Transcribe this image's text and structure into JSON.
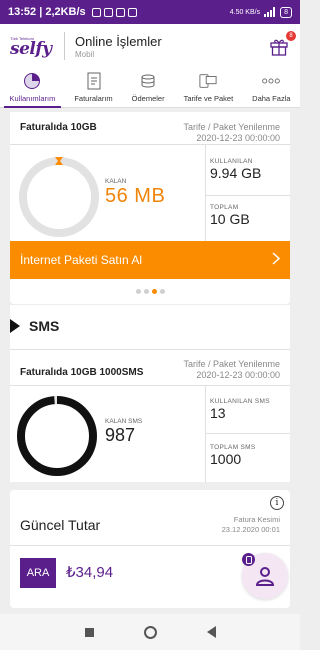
{
  "status_bar": {
    "text": "13:52 | 2,2KB/s",
    "right_small": "4.50 KB/s",
    "battery": "8"
  },
  "header": {
    "logo_small": "Türk Telekom",
    "logo": "selfy",
    "title": "Online İşlemler",
    "subtitle": "Mobil",
    "gift_badge": "8"
  },
  "nav": {
    "items": [
      {
        "label": "Kullanımlarım",
        "icon": "pie-chart-icon"
      },
      {
        "label": "Faturalarım",
        "icon": "receipt-icon"
      },
      {
        "label": "Ödemeler",
        "icon": "coins-icon"
      },
      {
        "label": "Tarife ve Paket",
        "icon": "devices-icon"
      },
      {
        "label": "Daha Fazla",
        "icon": "more-icon"
      }
    ]
  },
  "internet_card": {
    "package": "Faturalıda 10GB",
    "renew_label": "Tarife / Paket Yenilenme",
    "renew_date": "2020-12-23 00:00:00",
    "remaining_label": "KALAN",
    "remaining_value": "56 MB",
    "used_label": "KULLANILAN",
    "used_value": "9.94 GB",
    "total_label": "TOPLAM",
    "total_value": "10 GB",
    "remaining_fraction": 0.005,
    "buy_label": "İnternet Paketi Satın Al",
    "pager": {
      "count": 4,
      "active": 2
    }
  },
  "sms_card": {
    "title": "SMS",
    "package": "Faturalıda 10GB 1000SMS",
    "renew_label": "Tarife / Paket Yenilenme",
    "renew_date": "2020-12-23 00:00:00",
    "remaining_label": "KALAN SMS",
    "remaining_value": "987",
    "used_label": "KULLANILAN SMS",
    "used_value": "13",
    "total_label": "TOPLAM SMS",
    "total_value": "1000",
    "remaining_fraction": 0.987
  },
  "bill_card": {
    "title": "Güncel Tutar",
    "date_label": "Fatura Kesimi",
    "date_value": "23.12.2020 00:01",
    "ara_label": "ARA",
    "amount": "₺34,94"
  },
  "colors": {
    "brand_purple": "#5b1f8c",
    "accent_orange": "#fb8c00",
    "ring_gray": "#e2e2e2",
    "ring_black": "#111111"
  }
}
